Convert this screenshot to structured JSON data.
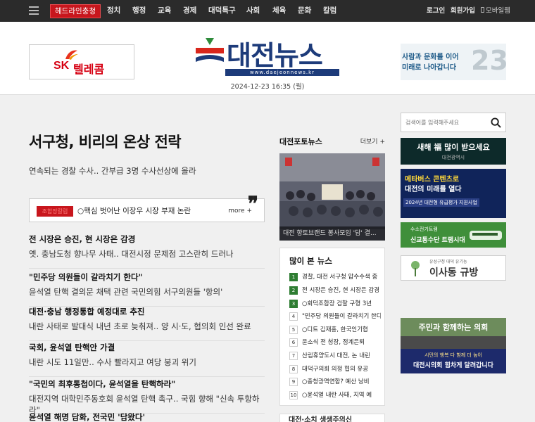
{
  "nav": {
    "headline_label": "헤드라인충청",
    "items": [
      "정치",
      "행정",
      "교육",
      "경제",
      "대덕특구",
      "사회",
      "체육",
      "문화",
      "칼럼"
    ],
    "login": "로그인",
    "signup": "회원가입",
    "mobile": "모바일웹"
  },
  "header": {
    "sk_brand": "SK",
    "sk_product": "텔레콤",
    "logo_text": "대전뉴스",
    "logo_url": "www.daejeonnews.kr",
    "date": "2024-12-23 16:35 (월)",
    "right_banner_line1": "사람과 문화를 이어",
    "right_banner_line2": "미래로 나아갑니다",
    "right_banner_number": "23"
  },
  "main": {
    "top_headline": "서구청, 비리의 온상 전락",
    "top_sub": "연속되는 경찰 수사.. 간부급 3명 수사선상에 올라",
    "quote_tag": "조합장칼럼",
    "quote_text": "○핵심 벗어난 이장우 시장 부재 논란",
    "quote_more": "more +",
    "news": [
      {
        "title": "전 시장은 승진, 현 시장은 감경",
        "desc": "옛. 충남도청 향나무 사태.. 대전시정 문제점 고스란히 드러나"
      },
      {
        "title": "\"민주당 의원들이 갈라치기 한다\"",
        "desc": "윤석열 탄핵 결의문 채택 관련 국민의힘 서구의원들 '항의'"
      },
      {
        "title": "대전·충남 행정통합 예정대로 추진",
        "desc": "내란 사태로 발대식 내년 초로 늦춰져.. 양 시·도, 협의회 인선 완료"
      },
      {
        "title": "국회, 윤석열 탄핵안 가결",
        "desc": "내란 시도 11일만.. 수사 빨라지고 여당 붕괴 위기"
      },
      {
        "title": "\"국민의 최후통첩이다, 윤석열을 탄핵하라\"",
        "desc": "대전지역 대학민주동호회 윤석열 탄핵 촉구.. 국힘 향해 \"신속 투항하라\""
      },
      {
        "title": "윤석열 해명 담화, 전국민 '답왔다'",
        "desc": ""
      }
    ]
  },
  "photo_news": {
    "title": "대전포토뉴스",
    "more": "더보기 +",
    "caption": "대전 향토브랜드 봉사모임 '담' 결..."
  },
  "popular": {
    "title": "많이 본 뉴스",
    "items": [
      "경찰, 대전 서구청 압수수색 중",
      "전 시장은 승진, 현 시장은 감경",
      "○회덕조합장 검찰 구형 3년",
      "\"민주당 의원들이 갈라치기 한다\"",
      "○디트 김재홍, 한국인기협",
      "윤소식 전 청장, 정계은퇴",
      "산림휴양도시 대전, 논 내린",
      "대덕구의회 의정 협의 유공",
      "○충청광역연합? 예산 낭비",
      "○윤석열 내란 사태, 지역 예"
    ]
  },
  "bottom_section_title": "대전·소치 생생주의신",
  "search": {
    "placeholder": "검색어를 입력해주세요"
  },
  "side_ads": {
    "ad1_text": "새해 福 많이 받으세요",
    "ad1_small": "대전광역시",
    "ad2_line1": "메타버스 콘텐츠로",
    "ad2_line2": "대전의 미래를 열다",
    "ad2_badge": "2024년 대전형 유급평가 지원사업",
    "ad3_line1": "수소전기트램",
    "ad3_line2": "신교통수단 트램시대",
    "ad4_small": "유성구청 대덕 유기농",
    "ad4_text": "이사동 규방",
    "ad5_text": "주민과 함께하는 의회",
    "ad6_line1": "시민의 행복 다 함께 더 높이",
    "ad6_line2": "대전시의회 힘차게 달려갑니다"
  },
  "colors": {
    "nav_bg": "#2b2b2b",
    "accent_red": "#c8161d",
    "logo_blue": "#1d3b7a",
    "popular_hot": "#2e7d32"
  }
}
